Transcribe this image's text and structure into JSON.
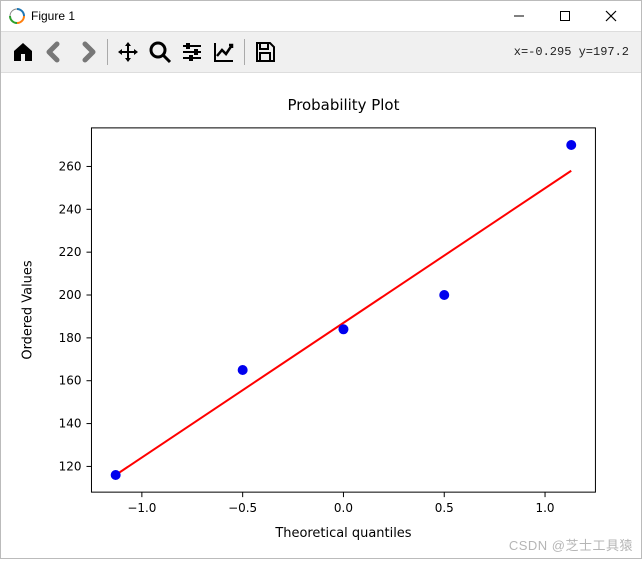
{
  "window": {
    "title": "Figure 1"
  },
  "toolbar": {
    "coord_text": "x=-0.295 y=197.2"
  },
  "watermark": "CSDN @芝士工具猿",
  "chart_data": {
    "type": "scatter",
    "title": "Probability Plot",
    "xlabel": "Theoretical quantiles",
    "ylabel": "Ordered Values",
    "x": [
      -1.13,
      -0.5,
      0.0,
      0.5,
      1.13
    ],
    "y": [
      116,
      165,
      184,
      200,
      270
    ],
    "fit_line": {
      "x": [
        -1.13,
        1.13
      ],
      "y": [
        116,
        258
      ]
    },
    "xticks": [
      -1.0,
      -0.5,
      0.0,
      0.5,
      1.0
    ],
    "yticks": [
      120,
      140,
      160,
      180,
      200,
      220,
      240,
      260
    ],
    "xlim": [
      -1.25,
      1.25
    ],
    "ylim": [
      108,
      278
    ]
  }
}
